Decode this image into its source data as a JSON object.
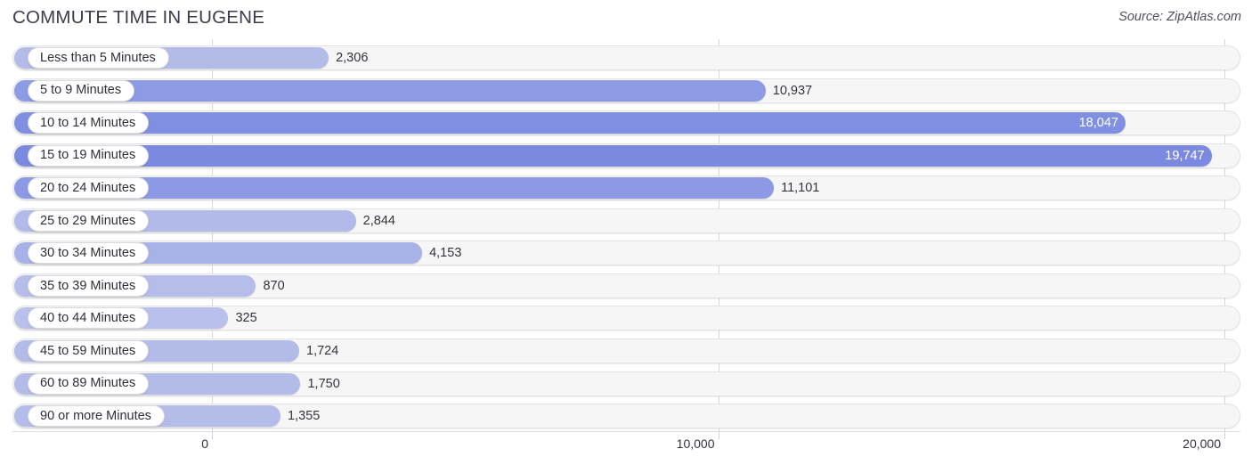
{
  "header": {
    "title": "COMMUTE TIME IN EUGENE",
    "source": "Source: ZipAtlas.com"
  },
  "chart_data": {
    "type": "bar",
    "orientation": "horizontal",
    "title": "COMMUTE TIME IN EUGENE",
    "subtitle": "",
    "xlabel": "",
    "ylabel": "",
    "xlim": [
      0,
      20000
    ],
    "grid": true,
    "legend": false,
    "source": "Source: ZipAtlas.com",
    "axis_ticks": [
      "0",
      "10,000",
      "20,000"
    ],
    "axis_tick_values": [
      0,
      10000,
      20000
    ],
    "categories": [
      "Less than 5 Minutes",
      "5 to 9 Minutes",
      "10 to 14 Minutes",
      "15 to 19 Minutes",
      "20 to 24 Minutes",
      "25 to 29 Minutes",
      "30 to 34 Minutes",
      "35 to 39 Minutes",
      "40 to 44 Minutes",
      "45 to 59 Minutes",
      "60 to 89 Minutes",
      "90 or more Minutes"
    ],
    "values": [
      2306,
      10937,
      18047,
      19747,
      11101,
      2844,
      4153,
      870,
      325,
      1724,
      1750,
      1355
    ],
    "value_labels": [
      "2,306",
      "10,937",
      "18,047",
      "19,747",
      "11,101",
      "2,844",
      "4,153",
      "870",
      "325",
      "1,724",
      "1,750",
      "1,355"
    ],
    "bar_colors": [
      "#b3bbe9",
      "#8d9ae4",
      "#808fe2",
      "#7b8ae0",
      "#8c99e4",
      "#b1bae9",
      "#a8b2e7",
      "#b6bdea",
      "#b8c0eb",
      "#b3bbe9",
      "#b3bbe9",
      "#b4bce9"
    ],
    "label_inside": [
      false,
      false,
      true,
      true,
      false,
      false,
      false,
      false,
      false,
      false,
      false,
      false
    ]
  },
  "style": {
    "track_color": "#f6f6f7",
    "track_border": "#e3e3e6",
    "gridline_color": "#d8d8dc",
    "title_color": "#3c3c4a",
    "value_color": "#34343c",
    "value_color_inside": "#ffffff"
  }
}
